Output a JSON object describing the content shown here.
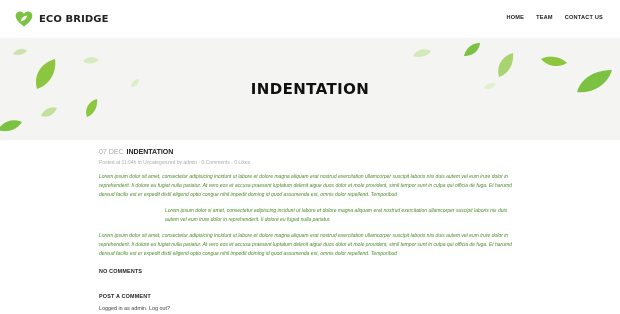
{
  "header": {
    "logo_text": "ECO BRIDGE",
    "nav": [
      "HOME",
      "TEAM",
      "CONTACT US"
    ]
  },
  "hero": {
    "title": "INDENTATION"
  },
  "post": {
    "date": "07 DEC",
    "title": "INDENTATION",
    "meta": "Posted at 11:04h in Uncategorized by admin  ·  0 Comments  ·  0 Likes",
    "paragraph1": "Lorem ipsum dolor sit amet, consectetur adipisicing incidunt ut labore et dolore magna aliquam erat nostrud exercitation ullamcorper suscipit laboris nisi duis autem vel eum irure dolor in reprehenderit. Ii dolore eu fugiat nulla pariatur. At vero eos et accusa praesent luptatum delenit aigue duos dolor et mole provident, simil tempor sunt in culpa qui officia de fuga. Et harumd dereud facilis est er expedit distil eligend optio congue nihil impedit doming id quod assumenda est, omnis dolor repellend. Temporibud",
    "quote": "Lorem ipsum dolor si amet, consectetur adipiscing incidunt ut labore et dolore magna aliquam erat nostrud exercitation ullamcorper suscipit laboris nis duis autem vel eum irure dolor in reprehenderit. Ii dolore eu fugiat nulla pariatur.",
    "paragraph2": "Lorem ipsum dolor sit amet, consectetur adipisicing incidunt ut labore et dolore magna aliquam erat nostrud exercitation ullamcorper suscipit laboris nisi duis autem vel eum irure dolor in reprehenderit. Ii dolore eu fugiat nulla pariatur. At vero eos et accusa praesent luptatum delenit aigue duos dolor et mole provident, simil tempor sunt in culpa qui officia de fuga. Et harumd dereud facilis est er expedit distil eligend optio congue nihil impedit doming id quod assumenda est, omnis dolor repellend. Temporibud"
  },
  "comments": {
    "no_comments": "NO COMMENTS",
    "post_comment": "POST A COMMENT",
    "logged_in": "Logged in as admin. Log out?"
  },
  "colors": {
    "accent": "#7cc242",
    "text_green": "#4a8c2a",
    "hero_bg": "#f4f4f3"
  }
}
